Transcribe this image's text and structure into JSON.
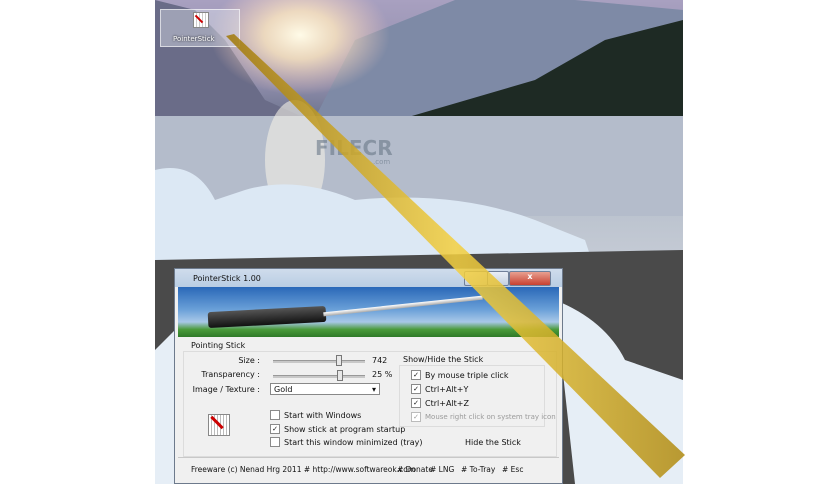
{
  "desktop": {
    "icon_label": "PointerStick",
    "watermark": "FILECR",
    "watermark_sub": ".com"
  },
  "window": {
    "title": "PointerStick 1.00",
    "close": "x"
  },
  "pointing": {
    "group_label": "Pointing Stick",
    "size_label": "Size :",
    "size_value": "742",
    "size_fraction": 0.72,
    "transparency_label": "Transparency :",
    "transparency_value": "25 %",
    "transparency_fraction": 0.73,
    "texture_label": "Image / Texture :",
    "texture_value": "Gold",
    "options": [
      {
        "label": "Start with Windows",
        "checked": false
      },
      {
        "label": "Show stick at program startup",
        "checked": true
      },
      {
        "label": "Start this window minimized (tray)",
        "checked": false
      }
    ]
  },
  "showhide": {
    "group_label": "Show/Hide the Stick",
    "options": [
      {
        "label": "By mouse triple click",
        "checked": true,
        "disabled": false
      },
      {
        "label": "Ctrl+Alt+Y",
        "checked": true,
        "disabled": false
      },
      {
        "label": "Ctrl+Alt+Z",
        "checked": true,
        "disabled": false
      },
      {
        "label": "Mouse right click on system tray icon",
        "checked": true,
        "disabled": true
      }
    ],
    "hide_button": "Hide the Stick"
  },
  "footer": {
    "copyright": "Freeware (c) Nenad Hrg 2011 # http://www.softwareok.com",
    "links": [
      "# Donate",
      "# LNG",
      "# To-Tray",
      "# Esc"
    ]
  }
}
